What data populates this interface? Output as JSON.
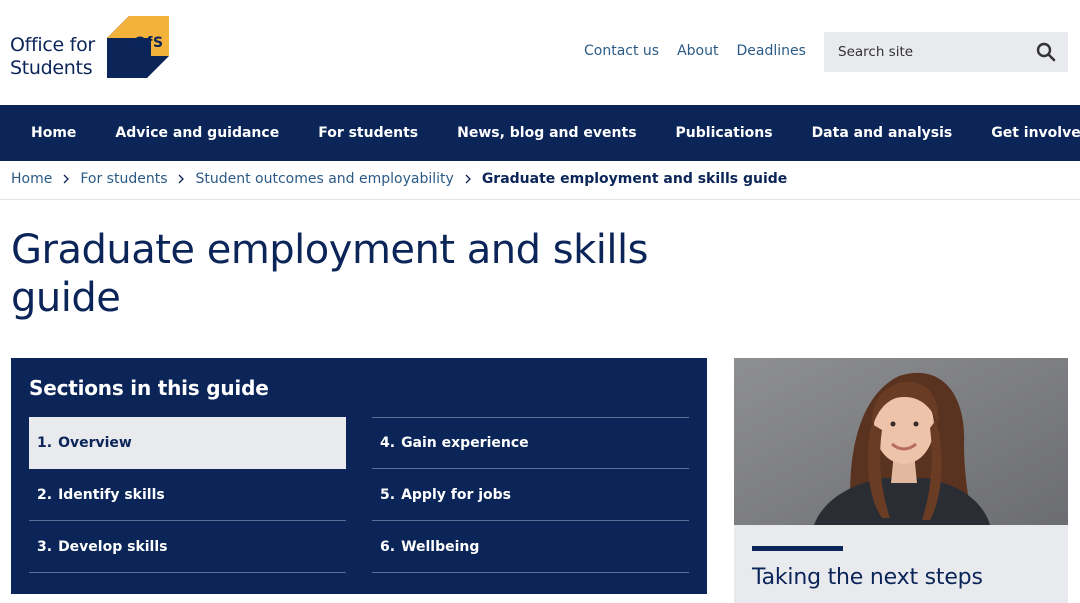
{
  "logo": {
    "line1": "Office for",
    "line2": "Students",
    "abbr": "OfS",
    "colors": {
      "navy": "#0b2559",
      "gold": "#f3b239"
    }
  },
  "header_links": [
    "Contact us",
    "About",
    "Deadlines"
  ],
  "search": {
    "placeholder": "Search site",
    "icon": "search-icon"
  },
  "nav": [
    "Home",
    "Advice and guidance",
    "For students",
    "News, blog and events",
    "Publications",
    "Data and analysis",
    "Get involved"
  ],
  "breadcrumb": {
    "items": [
      "Home",
      "For students",
      "Student outcomes and employability"
    ],
    "current": "Graduate employment and skills guide",
    "separator_icon": "chevron-right-icon"
  },
  "page_title": "Graduate employment and skills guide",
  "sections": {
    "heading": "Sections in this guide",
    "left": [
      {
        "num": "1.",
        "label": "Overview",
        "active": true
      },
      {
        "num": "2.",
        "label": "Identify skills"
      },
      {
        "num": "3.",
        "label": "Develop skills"
      }
    ],
    "right": [
      {
        "num": "4.",
        "label": "Gain experience"
      },
      {
        "num": "5.",
        "label": "Apply for jobs"
      },
      {
        "num": "6.",
        "label": "Wellbeing"
      }
    ]
  },
  "promo": {
    "title": "Taking the next steps"
  },
  "colors": {
    "navy": "#0b2559",
    "link": "#2b5a86",
    "light_grey": "#e8eaee"
  }
}
